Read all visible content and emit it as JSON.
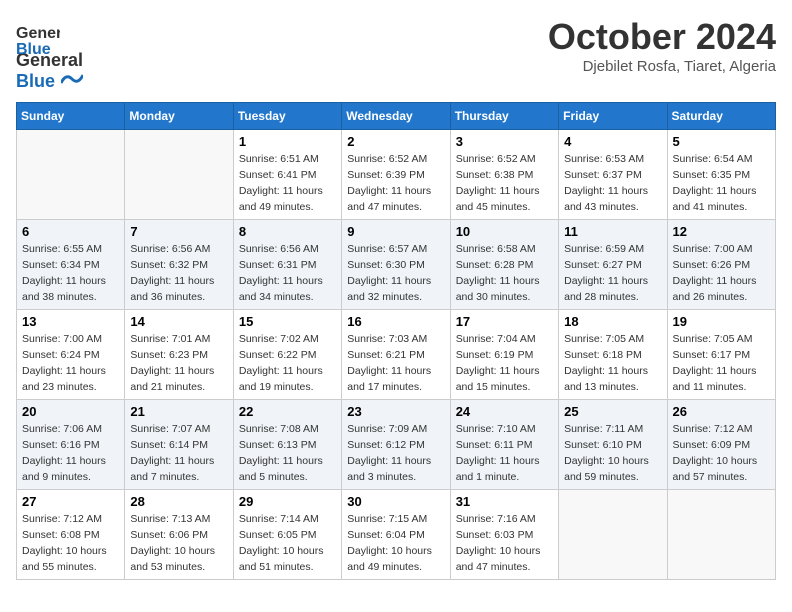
{
  "header": {
    "logo_line1": "General",
    "logo_line2": "Blue",
    "month": "October 2024",
    "location": "Djebilet Rosfa, Tiaret, Algeria"
  },
  "weekdays": [
    "Sunday",
    "Monday",
    "Tuesday",
    "Wednesday",
    "Thursday",
    "Friday",
    "Saturday"
  ],
  "weeks": [
    [
      {
        "day": "",
        "info": ""
      },
      {
        "day": "",
        "info": ""
      },
      {
        "day": "1",
        "info": "Sunrise: 6:51 AM\nSunset: 6:41 PM\nDaylight: 11 hours and 49 minutes."
      },
      {
        "day": "2",
        "info": "Sunrise: 6:52 AM\nSunset: 6:39 PM\nDaylight: 11 hours and 47 minutes."
      },
      {
        "day": "3",
        "info": "Sunrise: 6:52 AM\nSunset: 6:38 PM\nDaylight: 11 hours and 45 minutes."
      },
      {
        "day": "4",
        "info": "Sunrise: 6:53 AM\nSunset: 6:37 PM\nDaylight: 11 hours and 43 minutes."
      },
      {
        "day": "5",
        "info": "Sunrise: 6:54 AM\nSunset: 6:35 PM\nDaylight: 11 hours and 41 minutes."
      }
    ],
    [
      {
        "day": "6",
        "info": "Sunrise: 6:55 AM\nSunset: 6:34 PM\nDaylight: 11 hours and 38 minutes."
      },
      {
        "day": "7",
        "info": "Sunrise: 6:56 AM\nSunset: 6:32 PM\nDaylight: 11 hours and 36 minutes."
      },
      {
        "day": "8",
        "info": "Sunrise: 6:56 AM\nSunset: 6:31 PM\nDaylight: 11 hours and 34 minutes."
      },
      {
        "day": "9",
        "info": "Sunrise: 6:57 AM\nSunset: 6:30 PM\nDaylight: 11 hours and 32 minutes."
      },
      {
        "day": "10",
        "info": "Sunrise: 6:58 AM\nSunset: 6:28 PM\nDaylight: 11 hours and 30 minutes."
      },
      {
        "day": "11",
        "info": "Sunrise: 6:59 AM\nSunset: 6:27 PM\nDaylight: 11 hours and 28 minutes."
      },
      {
        "day": "12",
        "info": "Sunrise: 7:00 AM\nSunset: 6:26 PM\nDaylight: 11 hours and 26 minutes."
      }
    ],
    [
      {
        "day": "13",
        "info": "Sunrise: 7:00 AM\nSunset: 6:24 PM\nDaylight: 11 hours and 23 minutes."
      },
      {
        "day": "14",
        "info": "Sunrise: 7:01 AM\nSunset: 6:23 PM\nDaylight: 11 hours and 21 minutes."
      },
      {
        "day": "15",
        "info": "Sunrise: 7:02 AM\nSunset: 6:22 PM\nDaylight: 11 hours and 19 minutes."
      },
      {
        "day": "16",
        "info": "Sunrise: 7:03 AM\nSunset: 6:21 PM\nDaylight: 11 hours and 17 minutes."
      },
      {
        "day": "17",
        "info": "Sunrise: 7:04 AM\nSunset: 6:19 PM\nDaylight: 11 hours and 15 minutes."
      },
      {
        "day": "18",
        "info": "Sunrise: 7:05 AM\nSunset: 6:18 PM\nDaylight: 11 hours and 13 minutes."
      },
      {
        "day": "19",
        "info": "Sunrise: 7:05 AM\nSunset: 6:17 PM\nDaylight: 11 hours and 11 minutes."
      }
    ],
    [
      {
        "day": "20",
        "info": "Sunrise: 7:06 AM\nSunset: 6:16 PM\nDaylight: 11 hours and 9 minutes."
      },
      {
        "day": "21",
        "info": "Sunrise: 7:07 AM\nSunset: 6:14 PM\nDaylight: 11 hours and 7 minutes."
      },
      {
        "day": "22",
        "info": "Sunrise: 7:08 AM\nSunset: 6:13 PM\nDaylight: 11 hours and 5 minutes."
      },
      {
        "day": "23",
        "info": "Sunrise: 7:09 AM\nSunset: 6:12 PM\nDaylight: 11 hours and 3 minutes."
      },
      {
        "day": "24",
        "info": "Sunrise: 7:10 AM\nSunset: 6:11 PM\nDaylight: 11 hours and 1 minute."
      },
      {
        "day": "25",
        "info": "Sunrise: 7:11 AM\nSunset: 6:10 PM\nDaylight: 10 hours and 59 minutes."
      },
      {
        "day": "26",
        "info": "Sunrise: 7:12 AM\nSunset: 6:09 PM\nDaylight: 10 hours and 57 minutes."
      }
    ],
    [
      {
        "day": "27",
        "info": "Sunrise: 7:12 AM\nSunset: 6:08 PM\nDaylight: 10 hours and 55 minutes."
      },
      {
        "day": "28",
        "info": "Sunrise: 7:13 AM\nSunset: 6:06 PM\nDaylight: 10 hours and 53 minutes."
      },
      {
        "day": "29",
        "info": "Sunrise: 7:14 AM\nSunset: 6:05 PM\nDaylight: 10 hours and 51 minutes."
      },
      {
        "day": "30",
        "info": "Sunrise: 7:15 AM\nSunset: 6:04 PM\nDaylight: 10 hours and 49 minutes."
      },
      {
        "day": "31",
        "info": "Sunrise: 7:16 AM\nSunset: 6:03 PM\nDaylight: 10 hours and 47 minutes."
      },
      {
        "day": "",
        "info": ""
      },
      {
        "day": "",
        "info": ""
      }
    ]
  ]
}
